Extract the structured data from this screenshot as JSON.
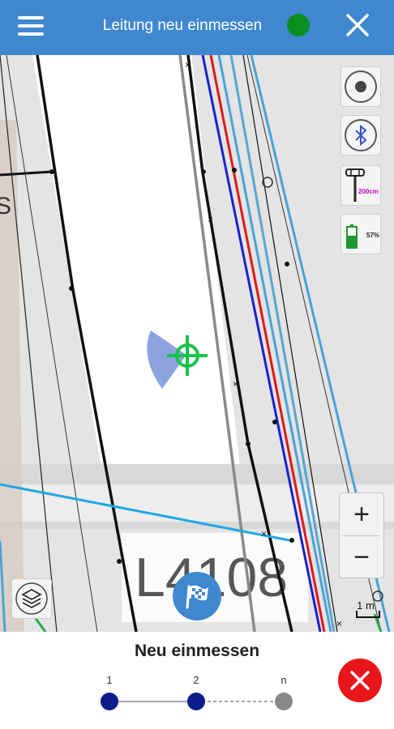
{
  "header": {
    "title": "Leitung neu einmessen",
    "menu_icon": "hamburger-menu-icon",
    "status_color": "#0a8f1e",
    "close_icon": "close-icon"
  },
  "map": {
    "road_label": "L4108",
    "scale_label": "1 m",
    "tools": {
      "record_icon": "record-icon",
      "bluetooth_icon": "bluetooth-icon",
      "pole_height": "200cm",
      "battery_percent": "57%"
    },
    "zoom_in_label": "+",
    "zoom_out_label": "−"
  },
  "bottom": {
    "title": "Neu einmessen",
    "steps": [
      {
        "label": "1",
        "color": "#0c1d8a"
      },
      {
        "label": "2",
        "color": "#0c1d8a"
      },
      {
        "label": "n",
        "color": "#888888"
      }
    ]
  },
  "colors": {
    "primary": "#3f88cf",
    "danger": "#e8161c",
    "target": "#19c24a"
  }
}
